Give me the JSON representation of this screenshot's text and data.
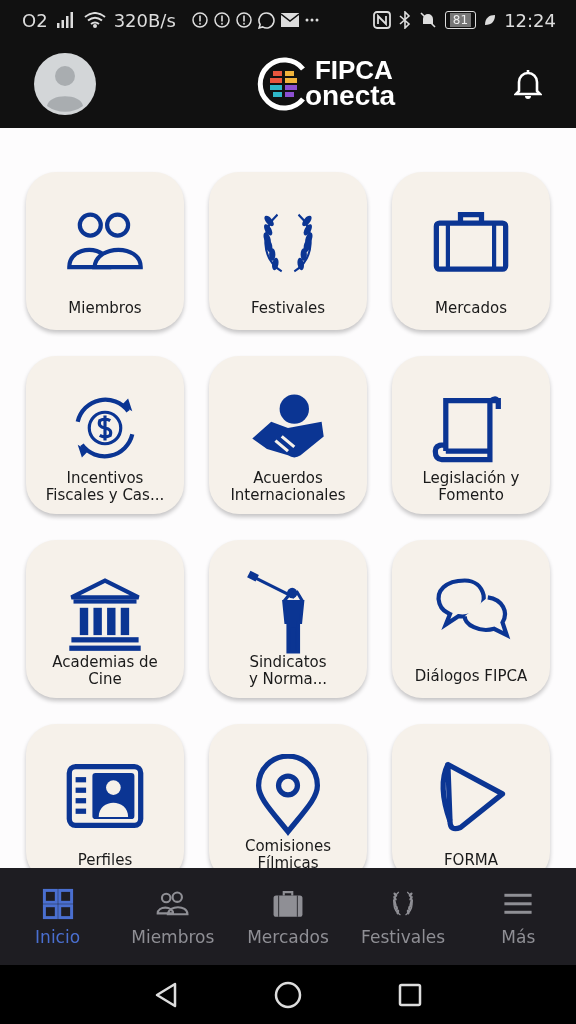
{
  "status_bar": {
    "carrier": "O2",
    "speed": "320B/s",
    "battery": "81",
    "time": "12:24"
  },
  "header": {
    "logo_line_1": "FIPCA",
    "logo_line_2": "onecta"
  },
  "tiles": [
    {
      "label": "Miembros"
    },
    {
      "label": "Festivales"
    },
    {
      "label": "Mercados"
    },
    {
      "label": "Incentivos\nFiscales y Cas..."
    },
    {
      "label": "Acuerdos\nInternacionales"
    },
    {
      "label": "Legislación y\nFomento"
    },
    {
      "label": "Academias de\nCine"
    },
    {
      "label": "Sindicatos\ny Norma..."
    },
    {
      "label": "Diálogos FIPCA"
    },
    {
      "label": "Perfiles"
    },
    {
      "label": "Comisiones\nFílmicas"
    },
    {
      "label": "FORMA"
    }
  ],
  "bottom_nav": [
    {
      "label": "Inicio",
      "selected": true
    },
    {
      "label": "Miembros",
      "selected": false
    },
    {
      "label": "Mercados",
      "selected": false
    },
    {
      "label": "Festivales",
      "selected": false
    },
    {
      "label": "Más",
      "selected": false
    }
  ]
}
